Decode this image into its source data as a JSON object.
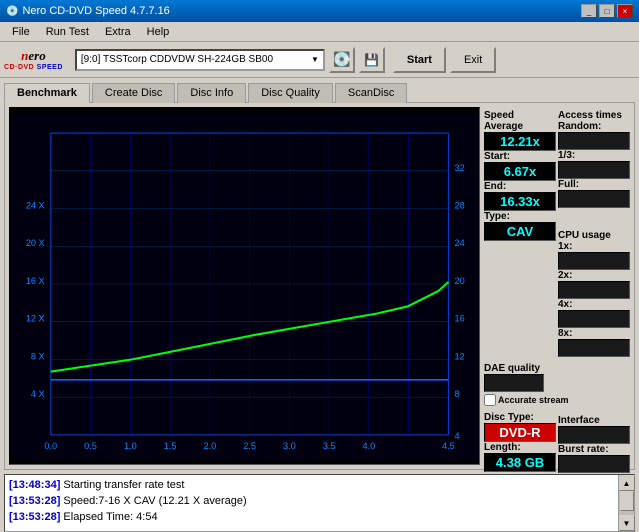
{
  "titlebar": {
    "title": "Nero CD-DVD Speed 4.7.7.16",
    "controls": [
      "_",
      "□",
      "×"
    ]
  },
  "menubar": {
    "items": [
      "File",
      "Run Test",
      "Extra",
      "Help"
    ]
  },
  "toolbar": {
    "logo_nero": "nero",
    "logo_sub": "CD·DVD SPEED",
    "drive": "[9:0]  TSSTcorp CDDVDW SH-224GB SB00",
    "start_label": "Start",
    "exit_label": "Exit"
  },
  "tabs": {
    "items": [
      "Benchmark",
      "Create Disc",
      "Disc Info",
      "Disc Quality",
      "ScanDisc"
    ],
    "active": "Benchmark"
  },
  "chart": {
    "x_labels": [
      "0.0",
      "0.5",
      "1.0",
      "1.5",
      "2.0",
      "2.5",
      "3.0",
      "3.5",
      "4.0",
      "4.5"
    ],
    "y_left_labels": [
      "4 X",
      "8 X",
      "12 X",
      "16 X",
      "20 X",
      "24 X"
    ],
    "y_right_labels": [
      "4",
      "8",
      "12",
      "16",
      "20",
      "24",
      "28",
      "32"
    ]
  },
  "stats": {
    "speed_label": "Speed",
    "average_label": "Average",
    "average_value": "12.21x",
    "start_label": "Start:",
    "start_value": "6.67x",
    "end_label": "End:",
    "end_value": "16.33x",
    "type_label": "Type:",
    "type_value": "CAV",
    "access_times_label": "Access times",
    "random_label": "Random:",
    "random_value": "",
    "one_third_label": "1/3:",
    "one_third_value": "",
    "full_label": "Full:",
    "full_value": "",
    "cpu_usage_label": "CPU usage",
    "cpu_1x_label": "1x:",
    "cpu_1x_value": "",
    "cpu_2x_label": "2x:",
    "cpu_2x_value": "",
    "cpu_4x_label": "4x:",
    "cpu_4x_value": "",
    "cpu_8x_label": "8x:",
    "cpu_8x_value": "",
    "dae_label": "DAE quality",
    "dae_value": "",
    "accurate_label": "Accurate stream",
    "disc_type_label": "Disc Type:",
    "disc_type_value": "DVD-R",
    "length_label": "Length:",
    "length_value": "4.38 GB",
    "interface_label": "Interface",
    "burst_label": "Burst rate:",
    "burst_value": ""
  },
  "log": {
    "lines": [
      {
        "timestamp": "[13:48:34]",
        "text": "Starting transfer rate test"
      },
      {
        "timestamp": "[13:53:28]",
        "text": "Speed:7-16 X CAV (12.21 X average)"
      },
      {
        "timestamp": "[13:53:28]",
        "text": "Elapsed Time: 4:54"
      }
    ]
  }
}
